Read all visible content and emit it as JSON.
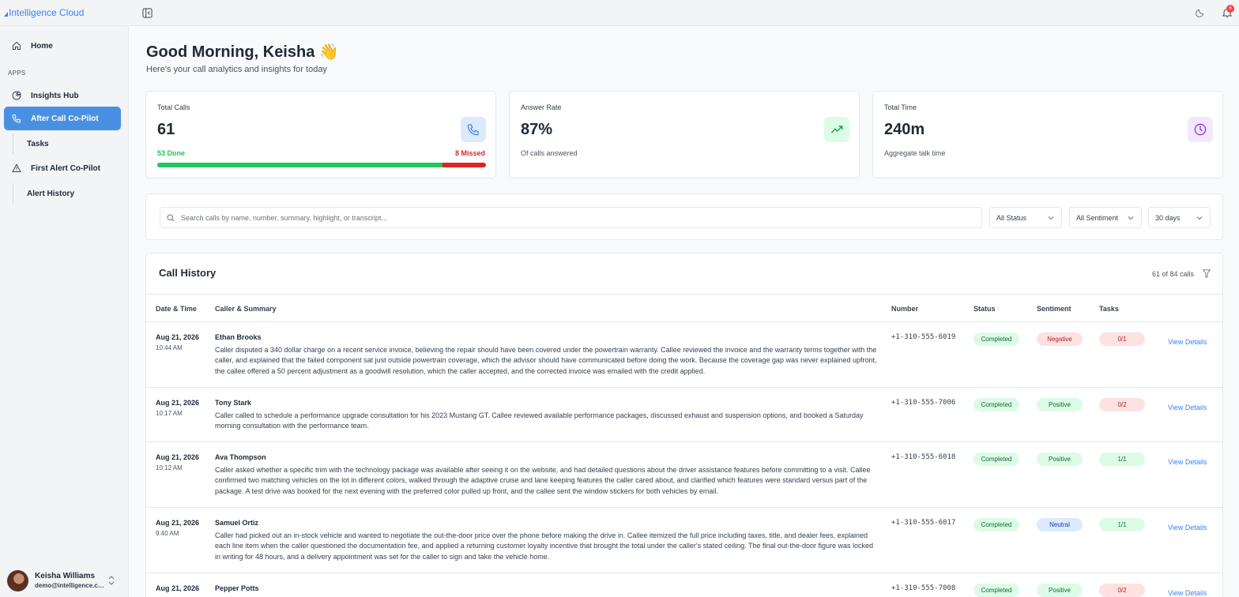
{
  "app": {
    "brand": "Intelligence Cloud",
    "notification_count": "6"
  },
  "sidebar": {
    "home": "Home",
    "section_apps": "APPS",
    "insights_hub": "Insights Hub",
    "after_call_copilot": "After Call Co-Pilot",
    "tasks": "Tasks",
    "first_alert_copilot": "First Alert Co-Pilot",
    "alert_history": "Alert History",
    "user": {
      "name": "Keisha Williams",
      "email": "demo@intelligence.cl..."
    }
  },
  "header": {
    "greeting": "Good Morning, Keisha 👋",
    "subtitle": "Here's your call analytics and insights for today"
  },
  "stats": {
    "total_calls": {
      "label": "Total Calls",
      "value": "61",
      "done_label": "53 Done",
      "missed_label": "8 Missed",
      "done": 53,
      "missed": 8
    },
    "answer_rate": {
      "label": "Answer Rate",
      "value": "87%",
      "sub": "Of calls answered"
    },
    "total_time": {
      "label": "Total Time",
      "value": "240m",
      "sub": "Aggregate talk time"
    }
  },
  "filters": {
    "search_placeholder": "Search calls by name, number, summary, highlight, or transcript...",
    "status": "All Status",
    "sentiment": "All Sentiment",
    "range": "30 days"
  },
  "history": {
    "title": "Call History",
    "count": "61 of 84 calls",
    "columns": {
      "date": "Date & Time",
      "caller": "Caller & Summary",
      "number": "Number",
      "status": "Status",
      "sentiment": "Sentiment",
      "tasks": "Tasks"
    },
    "view_label": "View Details",
    "rows": [
      {
        "date": "Aug 21, 2026",
        "time": "10:44 AM",
        "name": "Ethan Brooks",
        "summary": "Caller disputed a 340 dollar charge on a recent service invoice, believing the repair should have been covered under the powertrain warranty. Callee reviewed the invoice and the warranty terms together with the caller, and explained that the failed component sat just outside powertrain coverage, which the advisor should have communicated before doing the work. Because the coverage gap was never explained upfront, the callee offered a 50 percent adjustment as a goodwill resolution, which the caller accepted, and the corrected invoice was emailed with the credit applied.",
        "number": "+1-310-555-6019",
        "status": "Completed",
        "sentiment": "Negative",
        "tasks": "0/1"
      },
      {
        "date": "Aug 21, 2026",
        "time": "10:17 AM",
        "name": "Tony Stark",
        "summary": "Caller called to schedule a performance upgrade consultation for his 2023 Mustang GT. Callee reviewed available performance packages, discussed exhaust and suspension options, and booked a Saturday morning consultation with the performance team.",
        "number": "+1-310-555-7006",
        "status": "Completed",
        "sentiment": "Positive",
        "tasks": "0/2"
      },
      {
        "date": "Aug 21, 2026",
        "time": "10:12 AM",
        "name": "Ava Thompson",
        "summary": "Caller asked whether a specific trim with the technology package was available after seeing it on the website, and had detailed questions about the driver assistance features before committing to a visit. Callee confirmed two matching vehicles on the lot in different colors, walked through the adaptive cruise and lane keeping features the caller cared about, and clarified which features were standard versus part of the package. A test drive was booked for the next evening with the preferred color pulled up front, and the callee sent the window stickers for both vehicles by email.",
        "number": "+1-310-555-6018",
        "status": "Completed",
        "sentiment": "Positive",
        "tasks": "1/1"
      },
      {
        "date": "Aug 21, 2026",
        "time": "9:40 AM",
        "name": "Samuel Ortiz",
        "summary": "Caller had picked out an in-stock vehicle and wanted to negotiate the out-the-door price over the phone before making the drive in. Callee itemized the full price including taxes, title, and dealer fees, explained each line item when the caller questioned the documentation fee, and applied a returning customer loyalty incentive that brought the total under the caller's stated ceiling. The final out-the-door figure was locked in writing for 48 hours, and a delivery appointment was set for the caller to sign and take the vehicle home.",
        "number": "+1-310-555-6017",
        "status": "Completed",
        "sentiment": "Neutral",
        "tasks": "1/1"
      },
      {
        "date": "Aug 21, 2026",
        "time": "",
        "name": "Pepper Potts",
        "summary": "",
        "number": "+1-310-555-7008",
        "status": "Completed",
        "sentiment": "Positive",
        "tasks": "0/2"
      }
    ]
  },
  "colors": {
    "accent": "#4a90e2",
    "done": "#22c55e",
    "missed": "#dc2626",
    "link": "#3b82f6"
  },
  "icons": [
    "collapse-sidebar-icon",
    "moon-icon",
    "bell-icon",
    "home-icon",
    "pie-chart-icon",
    "phone-icon",
    "alert-triangle-icon",
    "trending-up-icon",
    "clock-icon",
    "search-icon",
    "chevron-down-icon",
    "filter-icon",
    "chevron-up-down-icon"
  ]
}
